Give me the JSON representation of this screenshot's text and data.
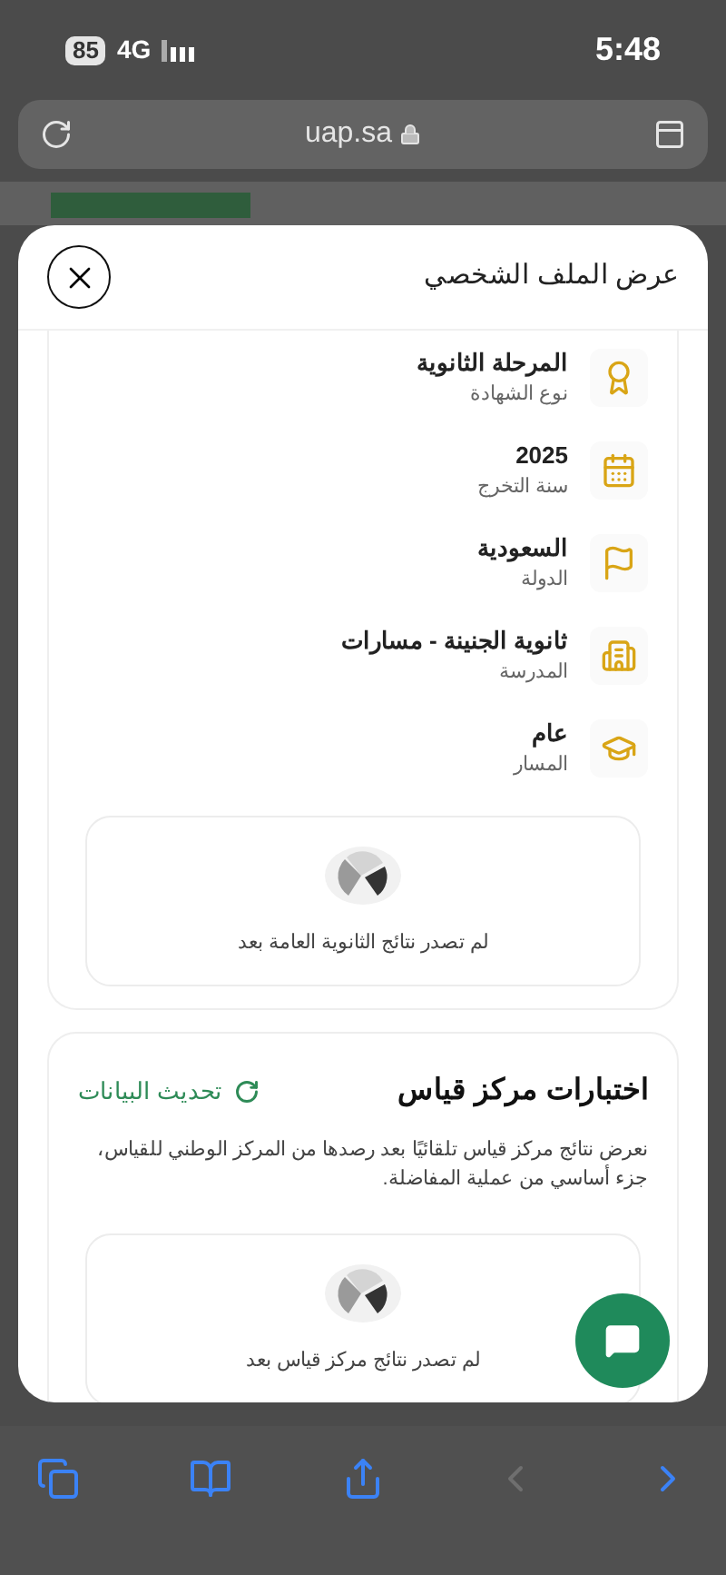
{
  "status_bar": {
    "battery": "85",
    "network": "4G",
    "time": "5:48"
  },
  "address_bar": {
    "url": "uap.sa"
  },
  "modal": {
    "title": "عرض الملف الشخصي",
    "info_items": [
      {
        "kind": "certificate",
        "value": "المرحلة الثانوية",
        "label": "نوع الشهادة"
      },
      {
        "kind": "calendar",
        "value": "2025",
        "label": "سنة التخرج"
      },
      {
        "kind": "flag",
        "value": "السعودية",
        "label": "الدولة"
      },
      {
        "kind": "building",
        "value": "ثانوية الجنينة - مسارات",
        "label": "المدرسة"
      },
      {
        "kind": "graduation",
        "value": "عام",
        "label": "المسار"
      }
    ],
    "results_empty": "لم تصدر نتائج الثانوية العامة بعد",
    "qiyas": {
      "title": "اختبارات مركز قياس",
      "refresh": "تحديث البيانات",
      "description": "نعرض نتائج مركز قياس تلقائيًا بعد رصدها من المركز الوطني للقياس، جزء أساسي من عملية المفاضلة.",
      "empty": "لم تصدر نتائج مركز قياس بعد"
    }
  },
  "toolbar": [
    {
      "kind": "tabs",
      "disabled": false
    },
    {
      "kind": "bookmarks",
      "disabled": false
    },
    {
      "kind": "share",
      "disabled": false
    },
    {
      "kind": "back",
      "disabled": true
    },
    {
      "kind": "forward",
      "disabled": false
    }
  ]
}
